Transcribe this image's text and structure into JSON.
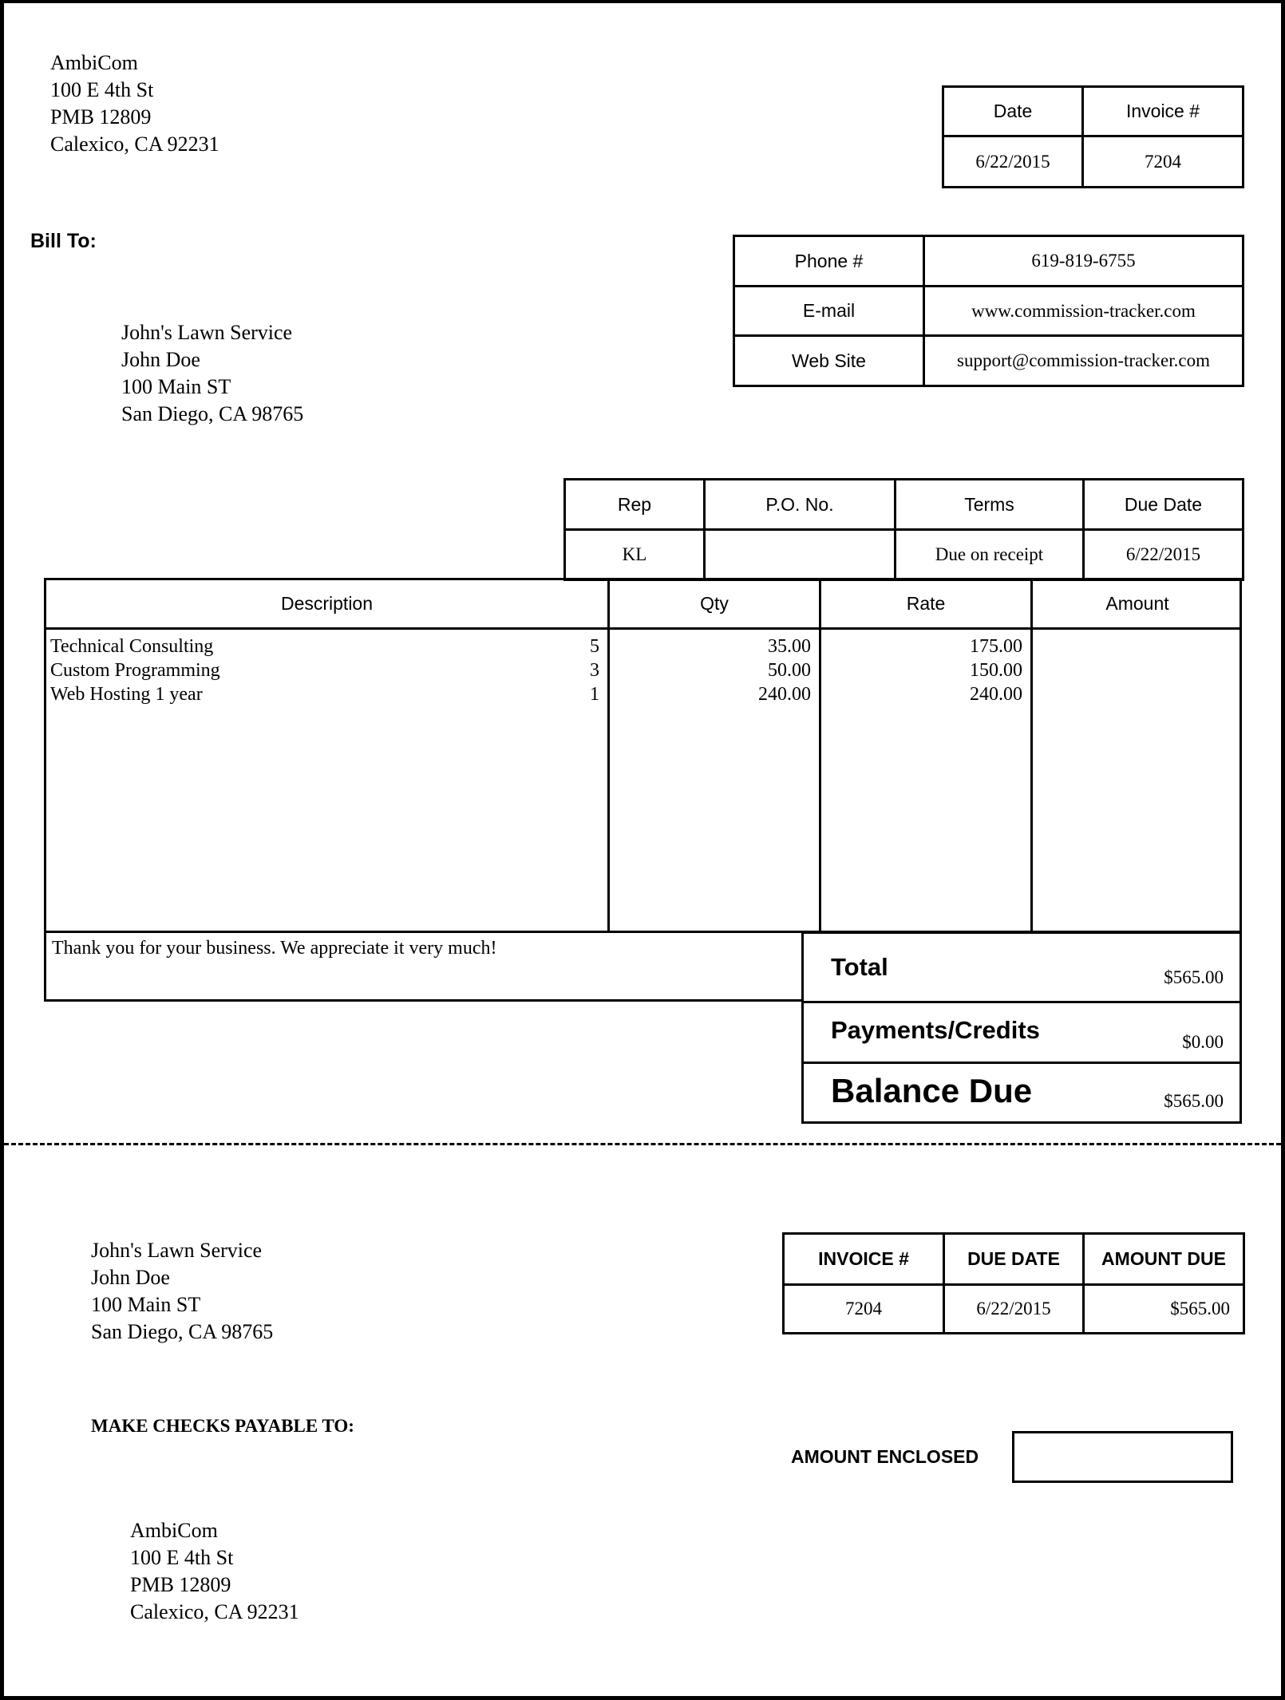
{
  "company": {
    "name": "AmbiCom",
    "address_line1": "100 E 4th St",
    "address_line2": "PMB 12809",
    "city_state_zip": "Calexico, CA 92231"
  },
  "invoice_header": {
    "date_label": "Date",
    "invoice_no_label": "Invoice #",
    "date": "6/22/2015",
    "invoice_no": "7204"
  },
  "bill_to": {
    "label": "Bill To:",
    "company": "John's Lawn Service",
    "contact": "John Doe",
    "street": "100 Main ST",
    "city_state_zip": "San Diego, CA 98765"
  },
  "contact_info": [
    {
      "label": "Phone #",
      "value": "619-819-6755"
    },
    {
      "label": "E-mail",
      "value": "www.commission-tracker.com"
    },
    {
      "label": "Web Site",
      "value": "support@commission-tracker.com"
    }
  ],
  "order_info": {
    "headers": [
      "Rep",
      "P.O. No.",
      "Terms",
      "Due Date"
    ],
    "values": [
      "KL",
      "",
      "Due on receipt",
      "6/22/2015"
    ]
  },
  "items_table": {
    "headers": [
      "Description",
      "Qty",
      "Rate",
      "Amount"
    ],
    "rows": [
      {
        "description": "Technical Consulting",
        "qty": "5",
        "rate": "35.00",
        "amount": "175.00"
      },
      {
        "description": "Custom Programming",
        "qty": "3",
        "rate": "50.00",
        "amount": "150.00"
      },
      {
        "description": "Web Hosting 1 year",
        "qty": "1",
        "rate": "240.00",
        "amount": "240.00"
      }
    ]
  },
  "note": "Thank you for your business.  We appreciate it very much!",
  "totals": {
    "total_label": "Total",
    "total": "$565.00",
    "payments_label": "Payments/Credits",
    "payments": "$0.00",
    "balance_label": "Balance Due",
    "balance": "$565.00"
  },
  "remittance": {
    "customer": {
      "company": "John's Lawn Service",
      "contact": "John Doe",
      "street": "100 Main ST",
      "city_state_zip": "San Diego, CA 98765"
    },
    "headers": [
      "INVOICE #",
      "DUE DATE",
      "AMOUNT DUE"
    ],
    "values": [
      "7204",
      "6/22/2015",
      "$565.00"
    ],
    "payable_to_label": "MAKE CHECKS PAYABLE TO:",
    "amount_enclosed_label": "AMOUNT ENCLOSED",
    "amount_enclosed_value": "",
    "payee": {
      "name": "AmbiCom",
      "address_line1": "100 E 4th St",
      "address_line2": "PMB 12809",
      "city_state_zip": "Calexico, CA 92231"
    }
  }
}
